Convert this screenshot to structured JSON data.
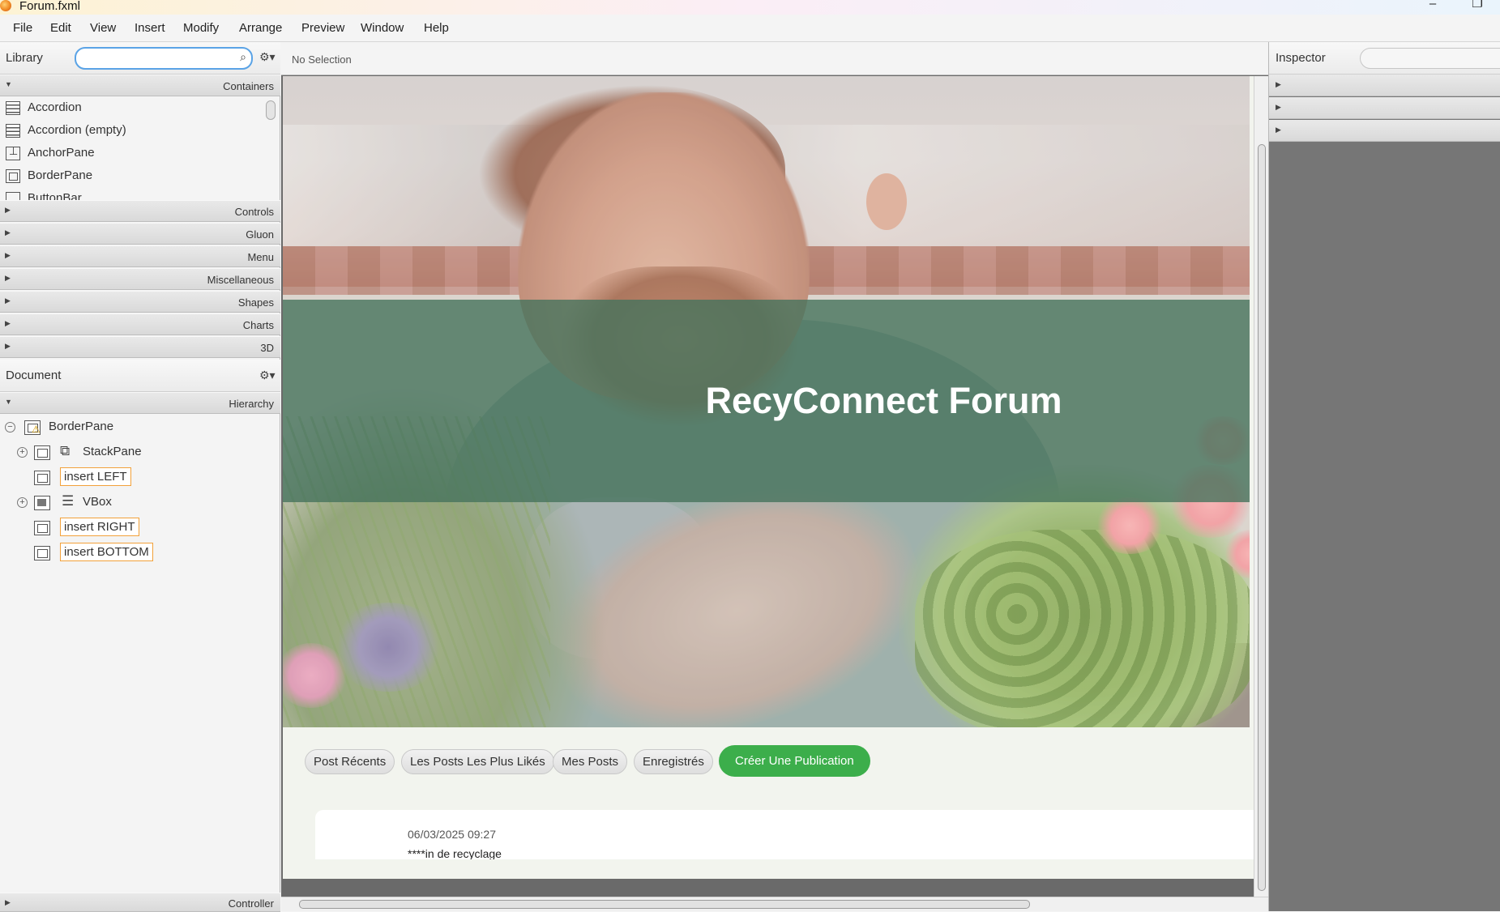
{
  "window": {
    "title": "Forum.fxml"
  },
  "menubar": [
    "File",
    "Edit",
    "View",
    "Insert",
    "Modify",
    "Arrange",
    "Preview",
    "Window",
    "Help"
  ],
  "library": {
    "title": "Library",
    "search": {
      "value": "",
      "placeholder": ""
    },
    "sections": {
      "containers": "Containers",
      "controls": "Controls",
      "gluon": "Gluon",
      "menu": "Menu",
      "misc": "Miscellaneous",
      "shapes": "Shapes",
      "charts": "Charts",
      "three_d": "3D"
    },
    "items": [
      "Accordion",
      "Accordion  (empty)",
      "AnchorPane",
      "BorderPane",
      "ButtonBar"
    ]
  },
  "document": {
    "title": "Document",
    "hierarchy_label": "Hierarchy",
    "tree": {
      "root": "BorderPane",
      "stackpane": "StackPane",
      "insert_left": "insert LEFT",
      "vbox": "VBox",
      "insert_right": "insert RIGHT",
      "insert_bottom": "insert BOTTOM"
    },
    "controller_label": "Controller"
  },
  "canvas": {
    "status": "No Selection",
    "hero_title": "RecyConnect Forum",
    "nav": {
      "recent": "Post Récents",
      "most_liked": "Les Posts Les Plus Likés",
      "my_posts": "Mes Posts",
      "saved": "Enregistrés",
      "create": "Créer Une Publication"
    },
    "post": {
      "date": "06/03/2025 09:27",
      "text": "****in de recyclage"
    }
  },
  "inspector": {
    "title": "Inspector"
  },
  "colors": {
    "banner": "#46735c",
    "create_button": "#3cae4b",
    "search_focus": "#5aa3e6",
    "slot_border": "#f2a13a"
  }
}
